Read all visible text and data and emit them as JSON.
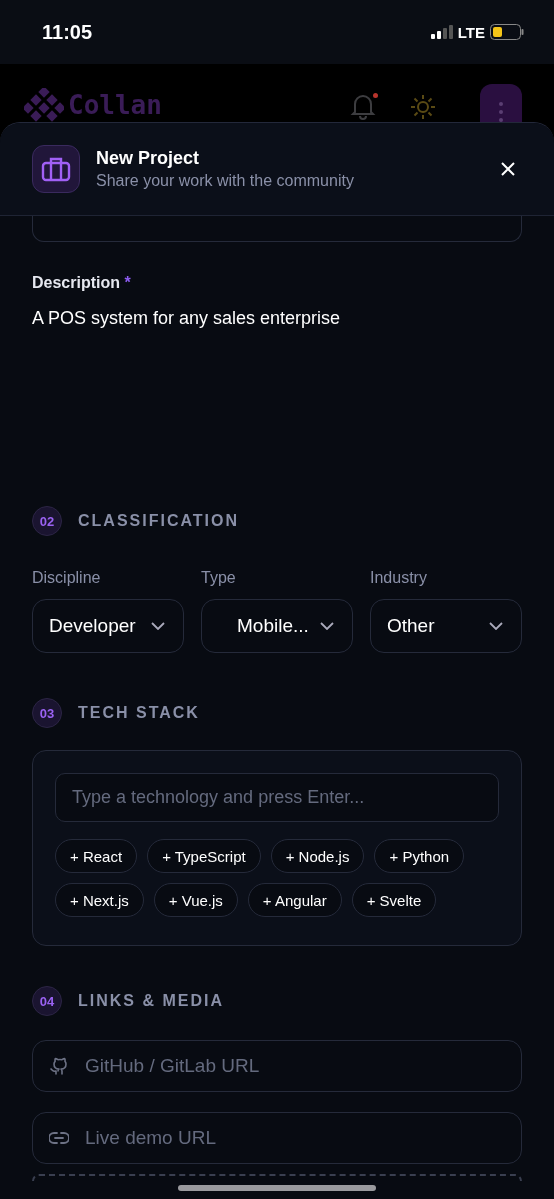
{
  "status_bar": {
    "time": "11:05",
    "network": "LTE"
  },
  "app_header": {
    "brand": "Collan",
    "notification_dot": true
  },
  "sheet": {
    "title": "New Project",
    "subtitle": "Share your work with the community"
  },
  "description": {
    "label": "Description",
    "required_mark": "*",
    "value": "A POS system for any sales enterprise"
  },
  "classification": {
    "number": "02",
    "title": "CLASSIFICATION",
    "selects": [
      {
        "label": "Discipline",
        "value": "Developer"
      },
      {
        "label": "Type",
        "value": "Mobile..."
      },
      {
        "label": "Industry",
        "value": "Other"
      }
    ]
  },
  "tech_stack": {
    "number": "03",
    "title": "TECH STACK",
    "placeholder": "Type a technology and press Enter...",
    "suggestions": [
      "+ React",
      "+ TypeScript",
      "+ Node.js",
      "+ Python",
      "+ Next.js",
      "+ Vue.js",
      "+ Angular",
      "+ Svelte"
    ]
  },
  "links": {
    "number": "04",
    "title": "LINKS & MEDIA",
    "fields": [
      {
        "kind": "repo",
        "placeholder": "GitHub / GitLab URL"
      },
      {
        "kind": "link",
        "placeholder": "Live demo URL"
      }
    ]
  }
}
